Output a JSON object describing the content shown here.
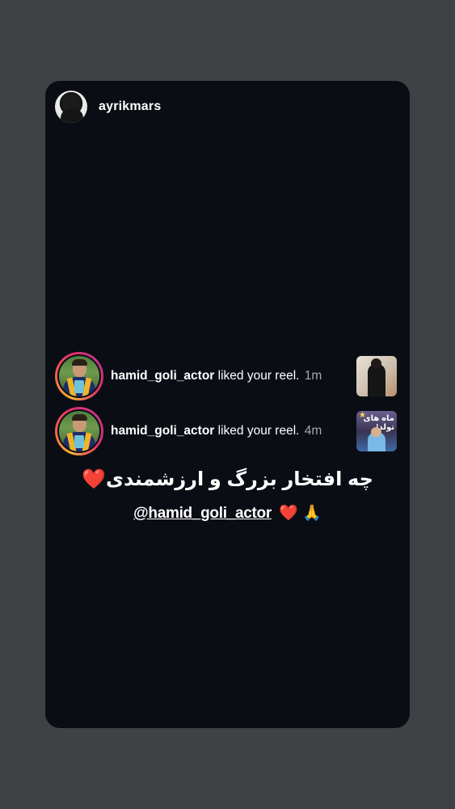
{
  "story": {
    "owner_username": "ayrikmars",
    "notifications": [
      {
        "username": "hamid_goli_actor",
        "action": "liked your reel.",
        "time": "1m"
      },
      {
        "username": "hamid_goli_actor",
        "action": "liked your reel.",
        "time": "4m",
        "thumbnail_caption": "ماه های تولد!"
      }
    ],
    "caption_text": "چه افتخار بزرگ و ارزشمندی",
    "caption_emoji": "❤️",
    "mention": "@hamid_goli_actor",
    "mention_emojis": {
      "heart": "❤️",
      "hands": "🙏"
    }
  },
  "colors": {
    "page_background": "#3f4244",
    "card_background": "#0a0d14",
    "timestamp": "#a8a8a8",
    "heart": "#e3262f"
  }
}
